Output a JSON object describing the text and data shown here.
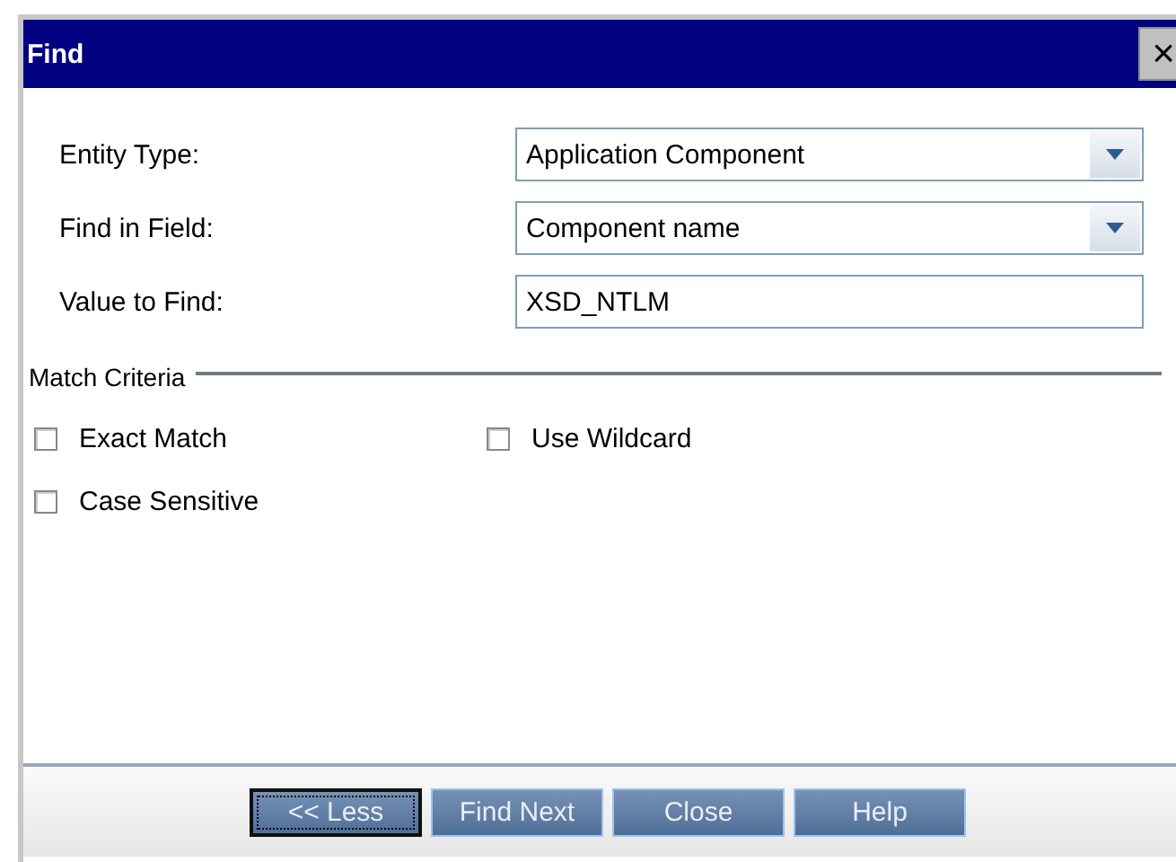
{
  "window": {
    "title": "Find",
    "close": "×"
  },
  "fields": [
    {
      "kind": "dropdown",
      "label": "Entity Type:",
      "value": "Application Component"
    },
    {
      "kind": "dropdown",
      "label": "Find in Field:",
      "value": "Component name"
    },
    {
      "kind": "text",
      "label": "Value to Find:",
      "value": "XSD_NTLM"
    }
  ],
  "match_criteria": {
    "title": "Match Criteria",
    "options": [
      {
        "label": "Exact Match",
        "checked": false
      },
      {
        "label": "Use Wildcard",
        "checked": false
      },
      {
        "label": "Case Sensitive",
        "checked": false
      }
    ]
  },
  "buttons": [
    {
      "label": "<< Less",
      "selected": true
    },
    {
      "label": "Find Next",
      "selected": false
    },
    {
      "label": "Close",
      "selected": false
    },
    {
      "label": "Help",
      "selected": false
    }
  ]
}
